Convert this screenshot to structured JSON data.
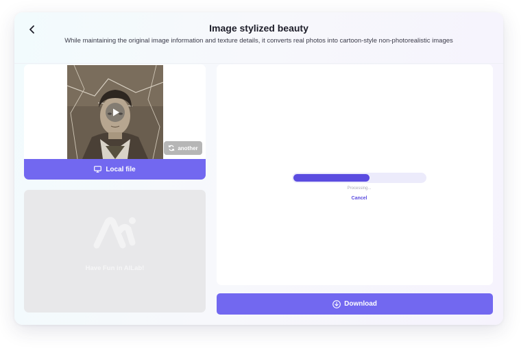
{
  "header": {
    "title": "Image stylized beauty",
    "subtitle": "While maintaining the original image information and texture details, it converts real photos into cartoon-style non-photorealistic images",
    "back_icon": "chevron-left-icon"
  },
  "upload": {
    "another_label": "another",
    "another_icon": "refresh-icon",
    "local_file_label": "Local file",
    "local_file_icon": "monitor-icon",
    "play_icon": "play-icon"
  },
  "placeholder": {
    "logo_icon": "ailab-logo-icon",
    "text": "Have Fun in AILab!"
  },
  "result": {
    "progress": 0.58,
    "status_text": "Processing...",
    "cancel_label": "Cancel"
  },
  "download": {
    "label": "Download",
    "icon": "download-icon"
  },
  "colors": {
    "accent": "#7268f0",
    "progress": "#5b4ce0",
    "progress_track": "#ecebfb",
    "placeholder_bg": "#e8e8ea"
  }
}
